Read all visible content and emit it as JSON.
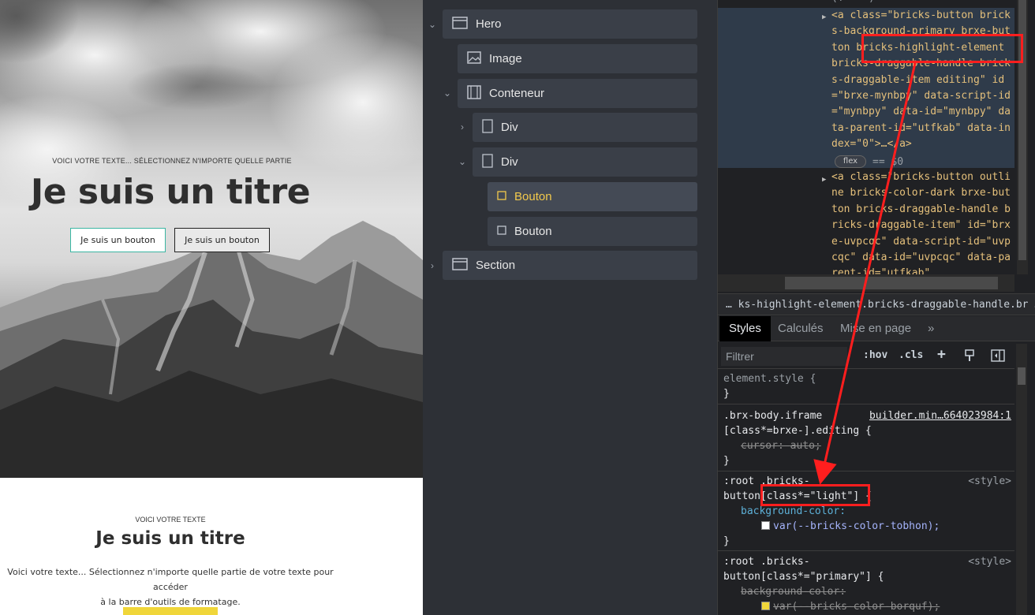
{
  "canvas": {
    "hero": {
      "eyebrow": "VOICI VOTRE TEXTE... SÉLECTIONNEZ N'IMPORTE QUELLE PARTIE",
      "title": "Je suis un titre",
      "button1": "Je suis un bouton",
      "button2": "Je suis un bouton"
    },
    "section": {
      "eyebrow": "VOICI VOTRE TEXTE",
      "title": "Je suis un titre",
      "text_line1": "Voici votre texte... Sélectionnez n'importe quelle partie de votre texte pour accéder",
      "text_line2": "à la barre d'outils de formatage."
    }
  },
  "structure": {
    "items": [
      {
        "label": "Hero",
        "icon": "section-icon"
      },
      {
        "label": "Image",
        "icon": "image-icon"
      },
      {
        "label": "Conteneur",
        "icon": "container-icon"
      },
      {
        "label": "Div",
        "icon": "div-icon"
      },
      {
        "label": "Div",
        "icon": "div-icon"
      },
      {
        "label": "Bouton",
        "icon": "button-icon",
        "active": true
      },
      {
        "label": "Bouton",
        "icon": "button-icon"
      },
      {
        "label": "Section",
        "icon": "section-icon"
      }
    ]
  },
  "devtools": {
    "elements": {
      "top_fragment": "(!----)",
      "selected_node": "<a class=\"bricks-button bricks-background-primary brxe-button bricks-highlight-element bricks-draggable-handle bricks-draggable-item editing\" id=\"brxe-mynbpy\" data-script-id=\"mynbpy\" data-id=\"mynbpy\" data-parent-id=\"utfkab\" data-index=\"0\">…</a>",
      "flex_badge": "flex",
      "eq0": "== $0",
      "next_node": "<a class=\"bricks-button outline bricks-color-dark brxe-button bricks-draggable-handle bricks-draggable-item\" id=\"brxe-uvpcqc\" data-script-id=\"uvpcqc\" data-id=\"uvpcqc\" data-parent-id=\"utfkab\""
    },
    "breadcrumb": "… ks-highlight-element.bricks-draggable-handle.br …",
    "tabs": [
      "Styles",
      "Calculés",
      "Mise en page"
    ],
    "tabs_more": "»",
    "filter_placeholder": "Filtrer",
    "hov": ":hov",
    "cls": ".cls",
    "rules": {
      "element_style": "element.style {",
      "close": "}",
      "r1_selector_a": ".brx-body.iframe",
      "r1_selector_b": "[class*=brxe-].editing {",
      "r1_source": "builder.min…664023984:1",
      "r1_prop": "cursor",
      "r1_val": "auto;",
      "r2_selector_a": ":root .bricks-",
      "r2_selector_b": "button",
      "r2_selector_c": "[class*=\"light\"]",
      "r2_selector_d": " {",
      "r2_source": "<style>",
      "r2_prop": "background-color:",
      "r2_val": "var(--bricks-color-tobhon);",
      "r3_selector_a": ":root .bricks-",
      "r3_selector_b": "button[class*=\"primary\"] {",
      "r3_source": "<style>",
      "r3_prop": "background-color:",
      "r3_val": "var(--bricks-color-borquf);"
    }
  },
  "colors": {
    "accent_yellow": "#f2c94c",
    "annotation_red": "#ff1e1e",
    "teal_border": "#3bb6a2"
  }
}
